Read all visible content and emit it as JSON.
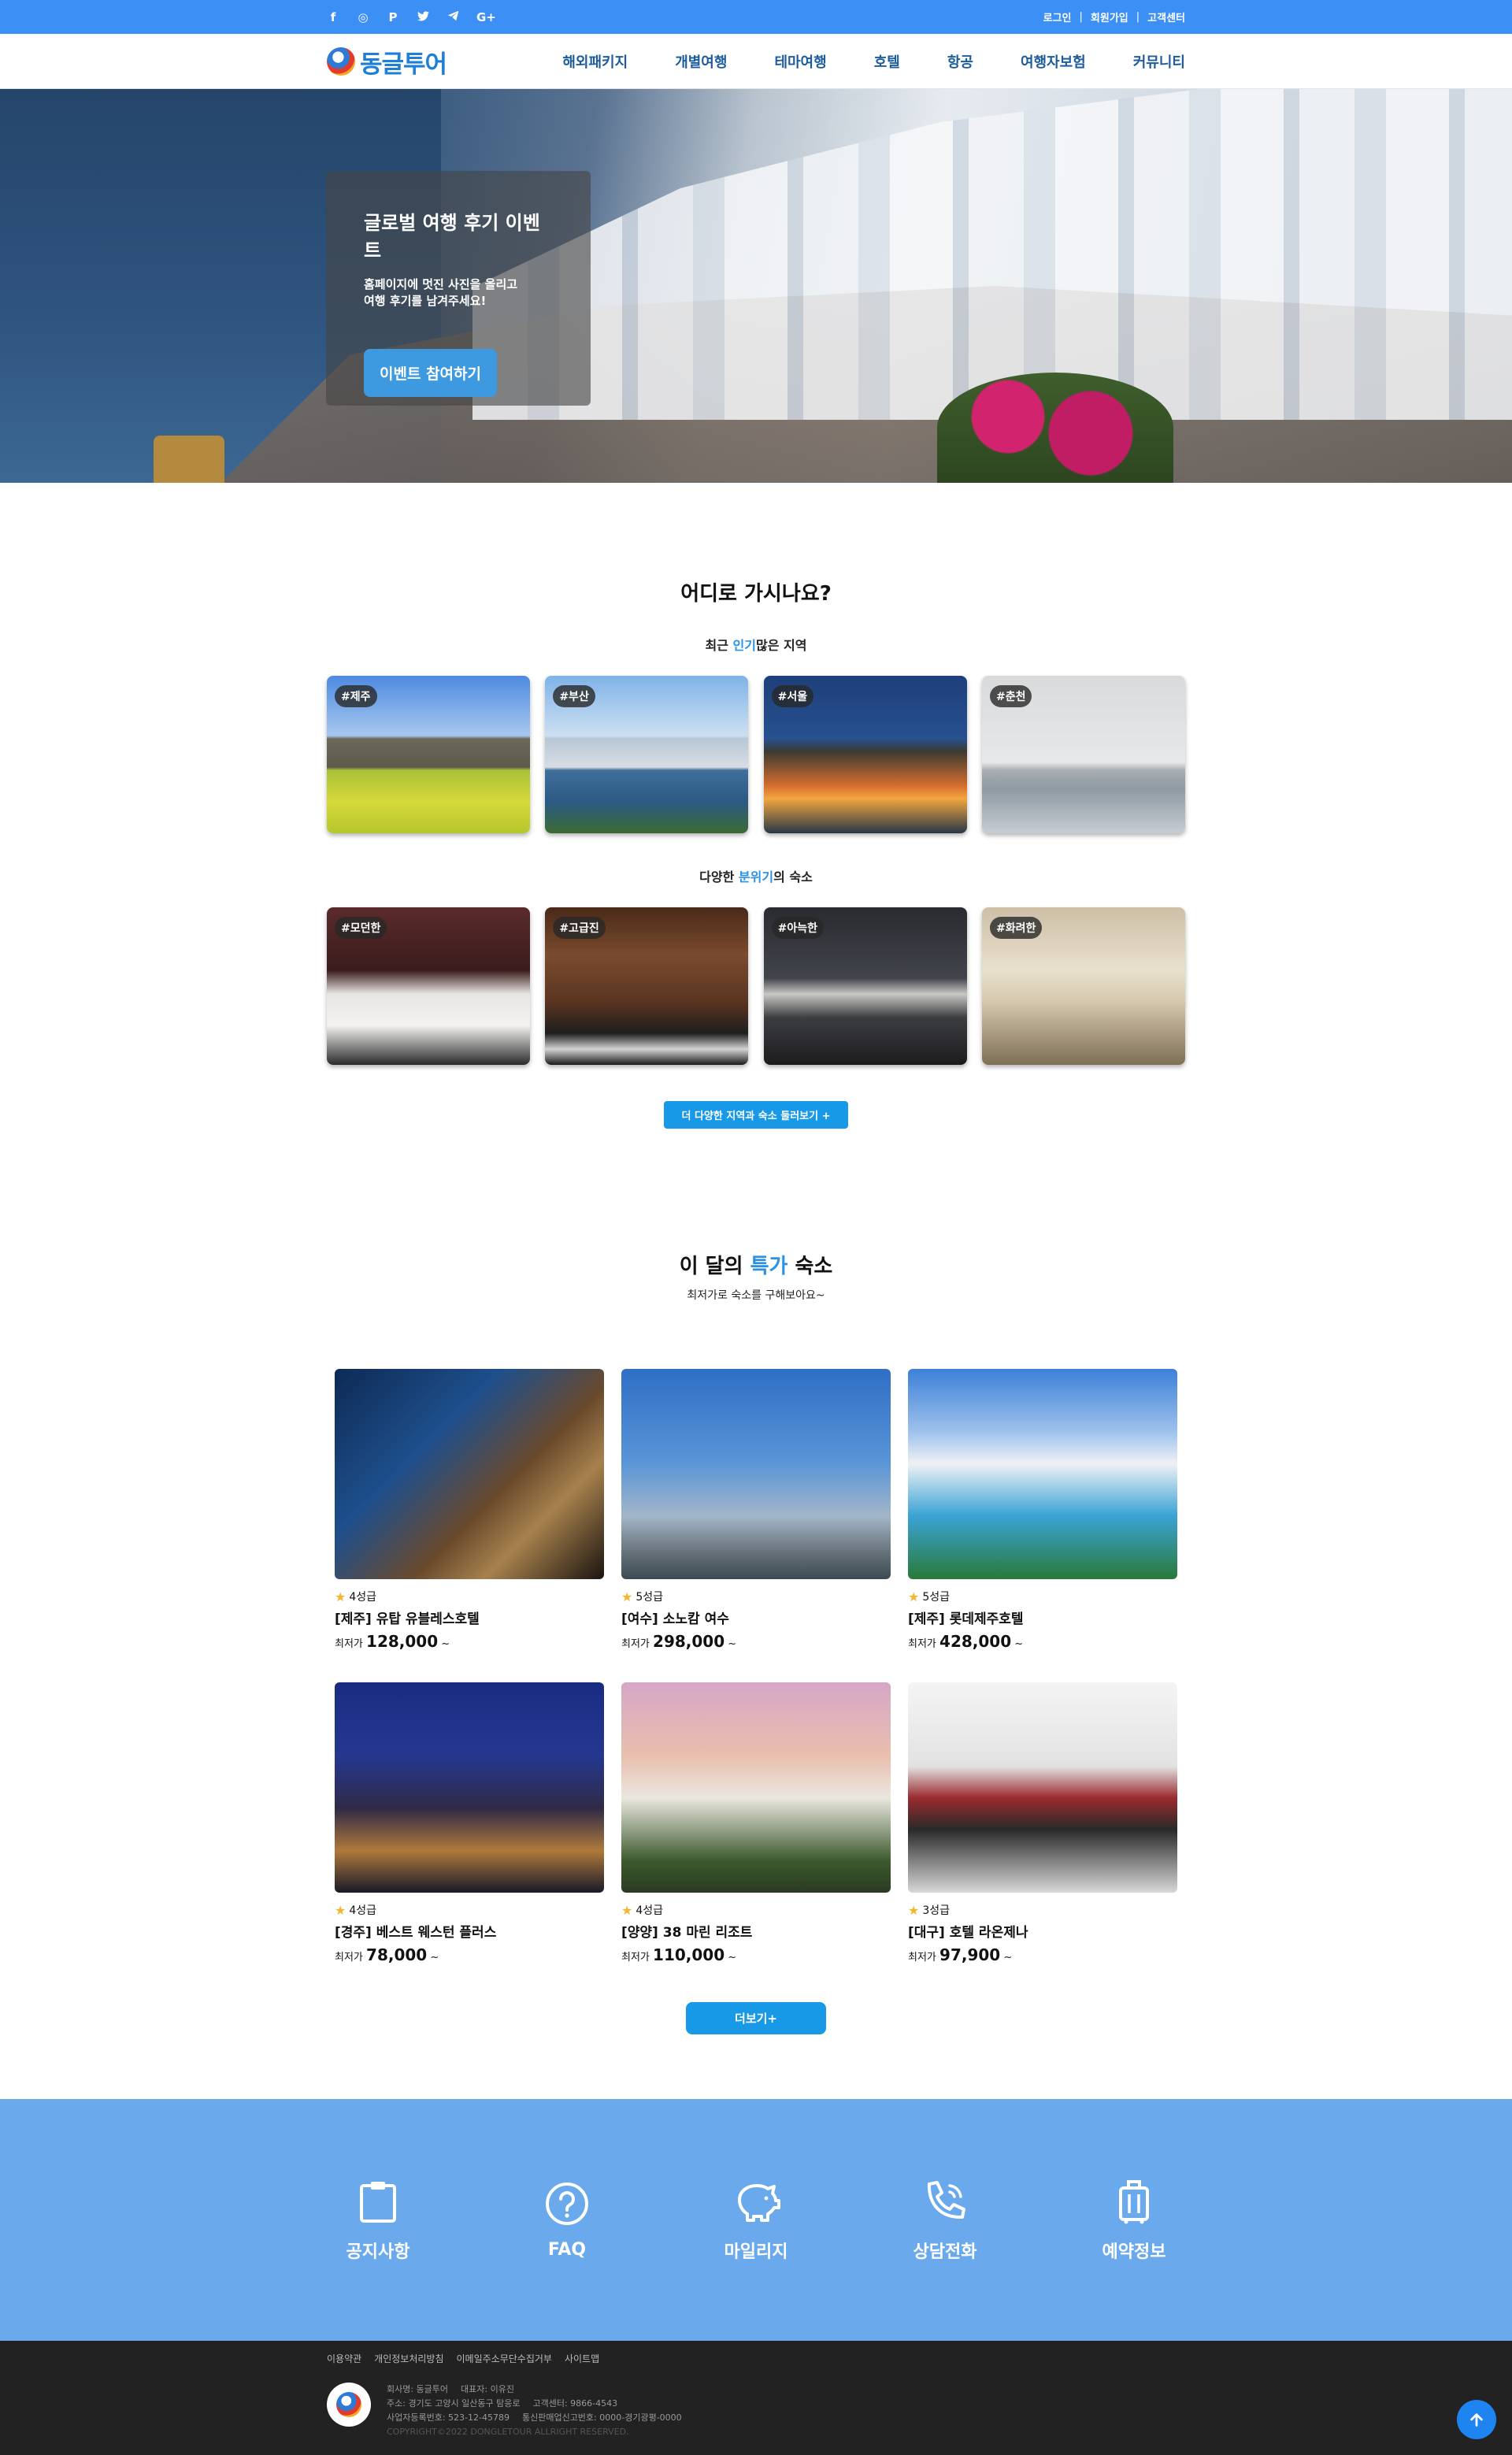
{
  "topbar": {
    "social_icons": [
      "facebook-icon",
      "instagram-icon",
      "pinterest-icon",
      "twitter-icon",
      "telegram-icon",
      "google-plus-icon"
    ],
    "social_glyphs": [
      "f",
      "◎",
      "P",
      "🐦",
      "➤",
      "G+"
    ],
    "login": "로그인",
    "signup": "회원가입",
    "support": "고객센터",
    "sep": "|"
  },
  "header": {
    "logo_text": "동글투어",
    "nav": [
      "해외패키지",
      "개별여행",
      "테마여행",
      "호텔",
      "항공",
      "여행자보험",
      "커뮤니티"
    ]
  },
  "hero": {
    "title": "글로벌 여행 후기 이벤트",
    "subtitle": "홈페이지에 멋진 사진을 올리고\n여행 후기를 남겨주세요!",
    "button": "이벤트 참여하기"
  },
  "where": {
    "title": "어디로 가시나요?",
    "sub_pre": "최근 ",
    "sub_hl": "인기",
    "sub_post": "많은 지역",
    "regions": [
      "#제주",
      "#부산",
      "#서울",
      "#춘천"
    ],
    "stay_pre": "다양한 ",
    "stay_hl": "분위기",
    "stay_post": "의 숙소",
    "moods": [
      "#모던한",
      "#고급진",
      "#아늑한",
      "#화려한"
    ],
    "more_button": "더 다양한 지역과 숙소 둘러보기 +"
  },
  "deal": {
    "title_pre": "이 달의 ",
    "title_hl": "특가",
    "title_post": " 숙소",
    "subtitle": "최저가로 숙소를 구해보아요~",
    "price_prefix": "최저가",
    "price_suffix": "~",
    "hotels": [
      {
        "grade": "4성급",
        "name": "[제주] 유탑 유블레스호텔",
        "price": "128,000"
      },
      {
        "grade": "5성급",
        "name": "[여수] 소노캄 여수",
        "price": "298,000"
      },
      {
        "grade": "5성급",
        "name": "[제주] 롯데제주호텔",
        "price": "428,000"
      },
      {
        "grade": "4성급",
        "name": "[경주] 베스트 웨스턴 플러스",
        "price": "78,000"
      },
      {
        "grade": "4성급",
        "name": "[양양] 38 마린 리조트",
        "price": "110,000"
      },
      {
        "grade": "3성급",
        "name": "[대구] 호텔 라온제나",
        "price": "97,900"
      }
    ],
    "more_button": "더보기+"
  },
  "quick": {
    "items": [
      {
        "icon": "clipboard-icon",
        "label": "공지사항"
      },
      {
        "icon": "question-icon",
        "label": "FAQ"
      },
      {
        "icon": "piggy-bank-icon",
        "label": "마일리지"
      },
      {
        "icon": "phone-icon",
        "label": "상담전화"
      },
      {
        "icon": "luggage-icon",
        "label": "예약정보"
      }
    ]
  },
  "footer": {
    "links": [
      "이용약관",
      "개인정보처리방침",
      "이메일주소무단수집거부",
      "사이트맵"
    ],
    "company": "회사명: 동글투어",
    "ceo": "대표자: 이유진",
    "address": "주소: 경기도 고양시 일산동구 탐응로",
    "tel": "고객센터: 9866-4543",
    "biz_no": "사업자등록번호: 523-12-45789",
    "mail_order": "통신판매업신고번호: 0000-경기광평-0000",
    "copyright": "COPYRIGHT©2022 DONGLETOUR ALLRIGHT RESERVED."
  },
  "colors": {
    "topbar": "#3b8ff5",
    "accent": "#2a92e5",
    "button": "#1899e8",
    "quick_bg": "#6aa9ec",
    "footer_bg": "#222222"
  }
}
